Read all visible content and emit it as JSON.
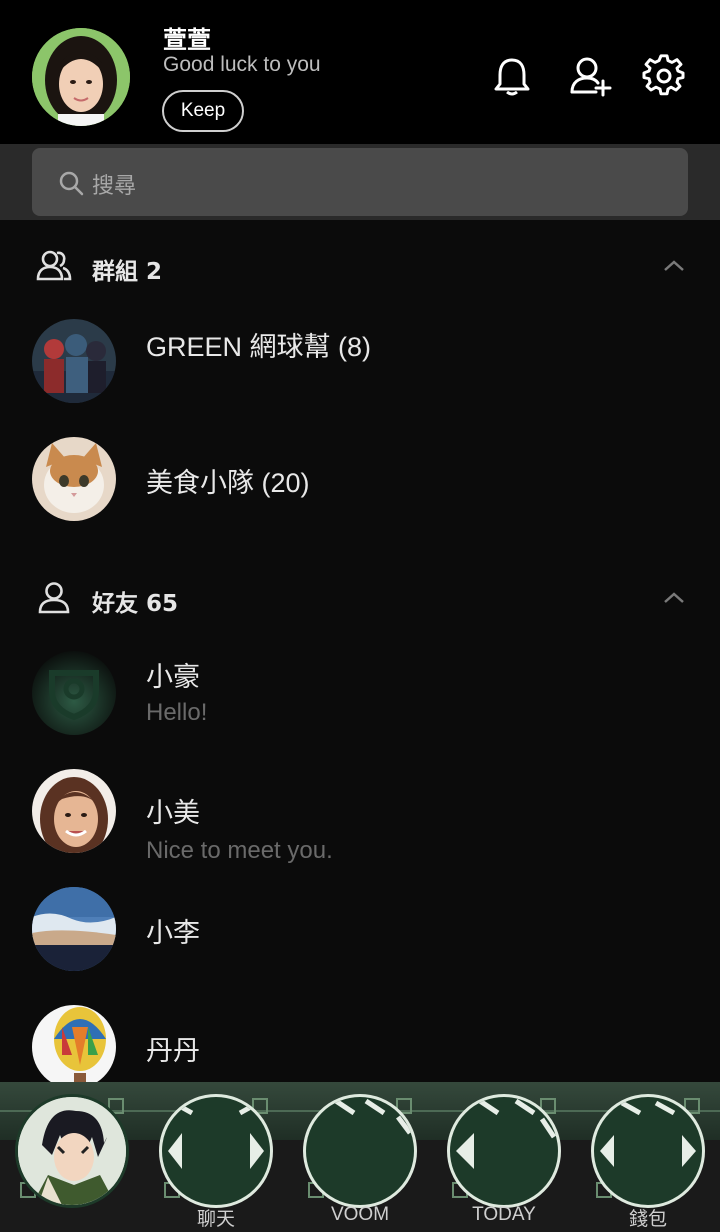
{
  "header": {
    "profile": {
      "name": "萱萱",
      "status": "Good luck to you",
      "keep_label": "Keep"
    },
    "icons": [
      "bell-icon",
      "add-friend-icon",
      "gear-icon"
    ]
  },
  "search": {
    "placeholder": "搜尋"
  },
  "groups": {
    "title": "群組 2",
    "items": [
      {
        "name": "GREEN 網球幫 (8)"
      },
      {
        "name": "美食小隊 (20)"
      }
    ]
  },
  "friends": {
    "title": "好友 65",
    "items": [
      {
        "name": "小豪",
        "status": "Hello!"
      },
      {
        "name": "小美",
        "status": "Nice to meet you."
      },
      {
        "name": "小李",
        "status": ""
      },
      {
        "name": "丹丹",
        "status": ""
      }
    ]
  },
  "bottom_nav": {
    "items": [
      {
        "label": ""
      },
      {
        "label": "聊天"
      },
      {
        "label": "VOOM"
      },
      {
        "label": "TODAY"
      },
      {
        "label": "錢包"
      }
    ]
  },
  "colors": {
    "background": "#0b0b0b",
    "accent": "#1d3a29",
    "search_bg": "#4a4a4a"
  }
}
